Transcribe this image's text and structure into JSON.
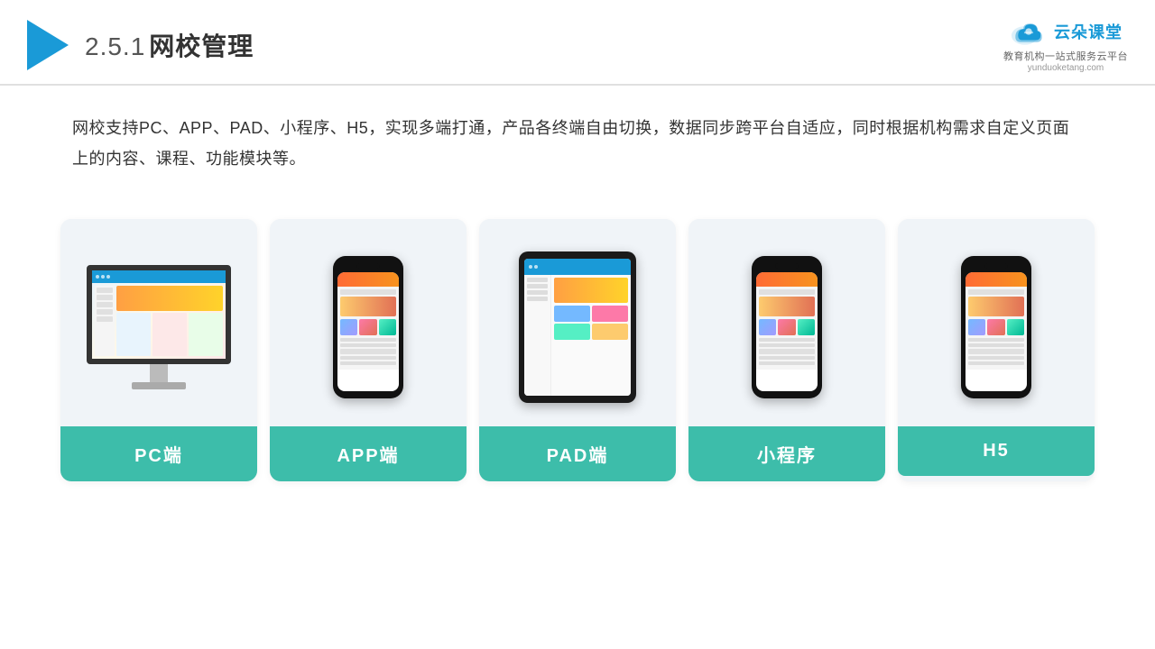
{
  "header": {
    "section": "2.5.1",
    "title": "网校管理",
    "brand_name": "云朵课堂",
    "brand_url": "yunduoketang.com",
    "brand_tagline": "教育机构一站\n式服务云平台"
  },
  "description": {
    "text": "网校支持PC、APP、PAD、小程序、H5，实现多端打通，产品各终端自由切换，数据同步跨平台自适应，同时根据机构需求自定义页面上的内容、课程、功能模块等。"
  },
  "cards": [
    {
      "id": "pc",
      "label": "PC端"
    },
    {
      "id": "app",
      "label": "APP端"
    },
    {
      "id": "pad",
      "label": "PAD端"
    },
    {
      "id": "miniprogram",
      "label": "小程序"
    },
    {
      "id": "h5",
      "label": "H5"
    }
  ]
}
